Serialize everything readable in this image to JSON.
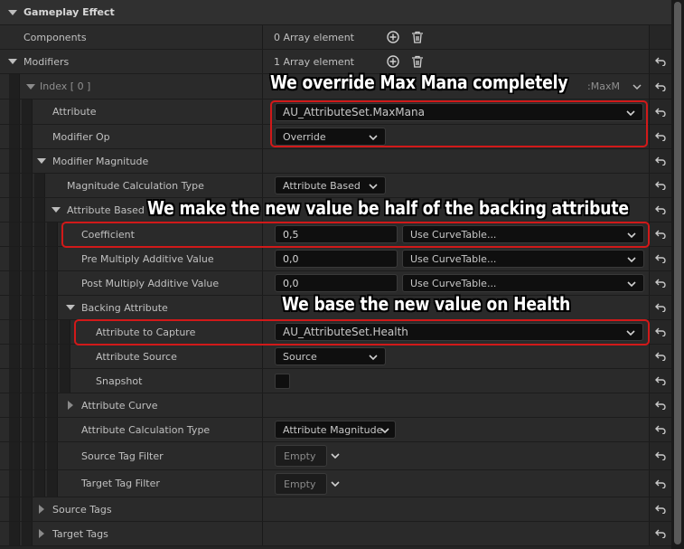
{
  "header": {
    "title": "Gameplay Effect"
  },
  "components": {
    "label": "Components",
    "value": "0 Array element"
  },
  "modifiers": {
    "label": "Modifiers",
    "value": "1 Array element"
  },
  "index": {
    "label": "Index [ 0 ]",
    "value_fragment": ":MaxM"
  },
  "attribute": {
    "label": "Attribute",
    "value": "AU_AttributeSet.MaxMana"
  },
  "modifier_op": {
    "label": "Modifier Op",
    "value": "Override"
  },
  "modifier_magnitude": {
    "label": "Modifier Magnitude"
  },
  "magnitude_calc_type": {
    "label": "Magnitude Calculation Type",
    "value": "Attribute Based"
  },
  "attribute_based": {
    "label": "Attribute Based M"
  },
  "coefficient": {
    "label": "Coefficient",
    "value": "0,5",
    "curve": "Use CurveTable..."
  },
  "pre_multiply": {
    "label": "Pre Multiply Additive Value",
    "value": "0,0",
    "curve": "Use CurveTable..."
  },
  "post_multiply": {
    "label": "Post Multiply Additive Value",
    "value": "0,0",
    "curve": "Use CurveTable..."
  },
  "backing_attribute": {
    "label": "Backing Attribute"
  },
  "attribute_to_capture": {
    "label": "Attribute to Capture",
    "value": "AU_AttributeSet.Health"
  },
  "attribute_source": {
    "label": "Attribute Source",
    "value": "Source"
  },
  "snapshot": {
    "label": "Snapshot",
    "checked": false
  },
  "attribute_curve": {
    "label": "Attribute Curve"
  },
  "attribute_calc_type": {
    "label": "Attribute Calculation Type",
    "value": "Attribute Magnitude"
  },
  "source_tag_filter": {
    "label": "Source Tag Filter",
    "value": "Empty"
  },
  "target_tag_filter": {
    "label": "Target Tag Filter",
    "value": "Empty"
  },
  "source_tags": {
    "label": "Source Tags"
  },
  "target_tags": {
    "label": "Target Tags"
  },
  "annotations": {
    "max_mana": "We override Max Mana completely",
    "half": "We make the new value be half of the backing attribute",
    "health": "We base the new value on Health"
  },
  "colors": {
    "highlight": "#d11919",
    "panel": "#2a2a2a",
    "field": "#0f0f0f"
  },
  "icons": [
    "add-icon",
    "trash-icon",
    "reset-arrow-icon",
    "chevron-down-icon",
    "expand-arrow-icon"
  ]
}
